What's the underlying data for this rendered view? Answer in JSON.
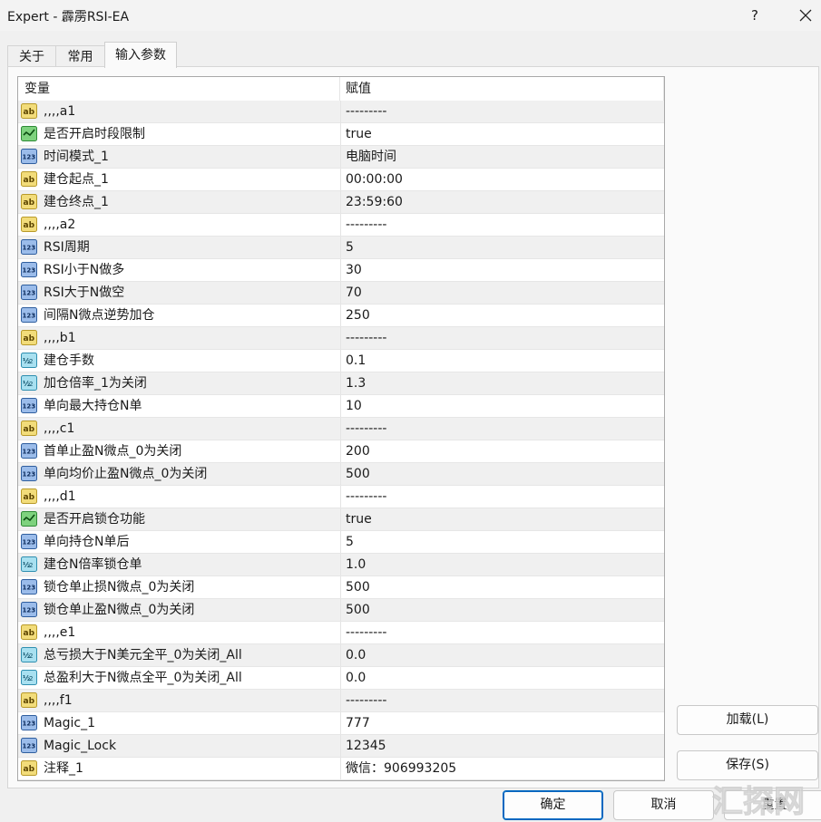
{
  "window": {
    "title": "Expert - 霹雳RSI-EA",
    "help": "?"
  },
  "tabs": [
    {
      "label": "关于"
    },
    {
      "label": "常用"
    },
    {
      "label": "输入参数"
    }
  ],
  "grid": {
    "col_variable": "变量",
    "col_value": "赋值",
    "rows": [
      {
        "type": "ab",
        "name": ",,,,a1",
        "value": "---------"
      },
      {
        "type": "bool",
        "name": "是否开启时段限制",
        "value": "true"
      },
      {
        "type": "123",
        "name": "时间模式_1",
        "value": "电脑时间"
      },
      {
        "type": "ab",
        "name": "建仓起点_1",
        "value": "00:00:00"
      },
      {
        "type": "ab",
        "name": "建仓终点_1",
        "value": "23:59:60"
      },
      {
        "type": "ab",
        "name": ",,,,a2",
        "value": "---------"
      },
      {
        "type": "123",
        "name": "RSI周期",
        "value": "5"
      },
      {
        "type": "123",
        "name": "RSI小于N做多",
        "value": "30"
      },
      {
        "type": "123",
        "name": "RSI大于N做空",
        "value": "70"
      },
      {
        "type": "123",
        "name": "间隔N微点逆势加仓",
        "value": "250"
      },
      {
        "type": "ab",
        "name": ",,,,b1",
        "value": "---------"
      },
      {
        "type": "v2",
        "name": "建仓手数",
        "value": "0.1"
      },
      {
        "type": "v2",
        "name": "加仓倍率_1为关闭",
        "value": "1.3"
      },
      {
        "type": "123",
        "name": "单向最大持仓N单",
        "value": "10"
      },
      {
        "type": "ab",
        "name": ",,,,c1",
        "value": "---------"
      },
      {
        "type": "123",
        "name": "首单止盈N微点_0为关闭",
        "value": "200"
      },
      {
        "type": "123",
        "name": "单向均价止盈N微点_0为关闭",
        "value": "500"
      },
      {
        "type": "ab",
        "name": ",,,,d1",
        "value": "---------"
      },
      {
        "type": "bool",
        "name": "是否开启锁仓功能",
        "value": "true"
      },
      {
        "type": "123",
        "name": "单向持仓N单后",
        "value": "5"
      },
      {
        "type": "v2",
        "name": "建仓N倍率锁仓单",
        "value": "1.0"
      },
      {
        "type": "123",
        "name": "锁仓单止损N微点_0为关闭",
        "value": "500"
      },
      {
        "type": "123",
        "name": "锁仓单止盈N微点_0为关闭",
        "value": "500"
      },
      {
        "type": "ab",
        "name": ",,,,e1",
        "value": "---------"
      },
      {
        "type": "v2",
        "name": "总亏损大于N美元全平_0为关闭_All",
        "value": "0.0"
      },
      {
        "type": "v2",
        "name": "总盈利大于N微点全平_0为关闭_All",
        "value": "0.0"
      },
      {
        "type": "ab",
        "name": ",,,,f1",
        "value": "---------"
      },
      {
        "type": "123",
        "name": "Magic_1",
        "value": "777"
      },
      {
        "type": "123",
        "name": "Magic_Lock",
        "value": "12345"
      },
      {
        "type": "ab",
        "name": "注释_1",
        "value": "微信：906993205"
      }
    ]
  },
  "buttons": {
    "load": "加载(L)",
    "save": "保存(S)",
    "ok": "确定",
    "cancel": "取消",
    "reset": "重置"
  },
  "watermark": "汇探网",
  "colors": {
    "ok_border": "#0067c0",
    "bool_icon": "#2e9a3a",
    "ab_icon": "#e0c050",
    "num_icon": "#3b6fb5",
    "v2_icon": "#3aa6c8"
  }
}
